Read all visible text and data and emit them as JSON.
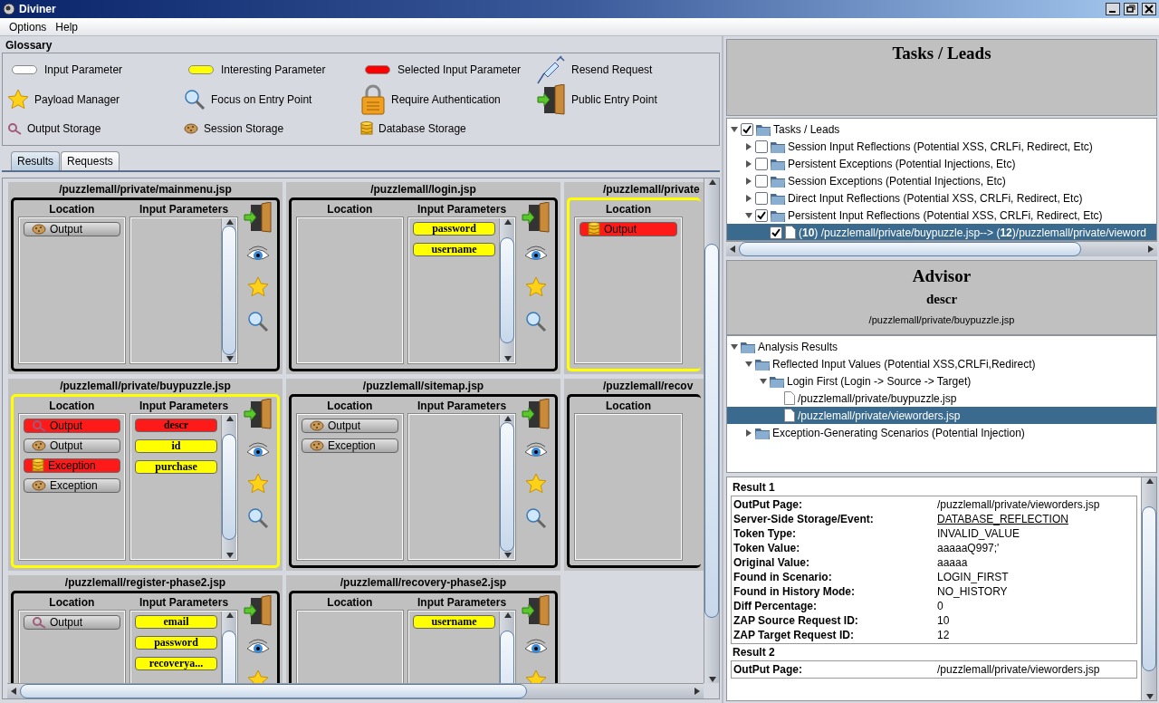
{
  "window": {
    "title": "Diviner"
  },
  "menu": [
    "Options",
    "Help"
  ],
  "glossary": {
    "title": "Glossary",
    "items": [
      {
        "label": "Input Parameter",
        "kind": "pill",
        "color": "#ffffff"
      },
      {
        "label": "Interesting Parameter",
        "kind": "pill",
        "color": "#ffff00"
      },
      {
        "label": "Selected Input Parameter",
        "kind": "pill",
        "color": "#ff0000"
      },
      {
        "label": "Resend Request",
        "kind": "syringe"
      },
      {
        "label": "Payload Manager",
        "kind": "star"
      },
      {
        "label": "Focus on Entry Point",
        "kind": "zoom"
      },
      {
        "label": "Require Authentication",
        "kind": "lock"
      },
      {
        "label": "Public Entry Point",
        "kind": "door"
      },
      {
        "label": "Output Storage",
        "kind": "output"
      },
      {
        "label": "Session Storage",
        "kind": "cookie"
      },
      {
        "label": "Database Storage",
        "kind": "db"
      }
    ]
  },
  "tabs": [
    {
      "label": "Results",
      "selected": true
    },
    {
      "label": "Requests",
      "selected": false
    }
  ],
  "cards": [
    {
      "title": "/puzzlemall/private/mainmenu.jsp",
      "highlighted": false,
      "partial": false,
      "location_header": "Location",
      "params_header": "Input Parameters",
      "locations": [
        {
          "label": "Output",
          "kind": "cookie",
          "selected": false
        }
      ]
    },
    {
      "title": "/puzzlemall/login.jsp",
      "highlighted": false,
      "partial": false,
      "location_header": "Location",
      "params_header": "Input Parameters",
      "params": [
        {
          "label": "password",
          "selected": false
        },
        {
          "label": "username",
          "selected": false
        }
      ]
    },
    {
      "title": "/puzzlemall/private",
      "highlighted": true,
      "partial": true,
      "location_header": "Location",
      "locations": [
        {
          "label": "Output",
          "kind": "db",
          "selected": true
        }
      ]
    },
    {
      "title": "/puzzlemall/private/buypuzzle.jsp",
      "highlighted": true,
      "partial": false,
      "location_header": "Location",
      "params_header": "Input Parameters",
      "locations": [
        {
          "label": "Output",
          "kind": "output",
          "selected": true
        },
        {
          "label": "Output",
          "kind": "cookie",
          "selected": false
        },
        {
          "label": "Exception",
          "kind": "db",
          "selected": true
        },
        {
          "label": "Exception",
          "kind": "cookie",
          "selected": false
        }
      ],
      "params": [
        {
          "label": "descr",
          "selected": true
        },
        {
          "label": "id",
          "selected": false
        },
        {
          "label": "purchase",
          "selected": false
        }
      ]
    },
    {
      "title": "/puzzlemall/sitemap.jsp",
      "highlighted": false,
      "partial": false,
      "location_header": "Location",
      "params_header": "Input Parameters",
      "locations": [
        {
          "label": "Output",
          "kind": "cookie",
          "selected": false
        },
        {
          "label": "Exception",
          "kind": "cookie",
          "selected": false
        }
      ]
    },
    {
      "title": "/puzzlemall/recov",
      "highlighted": false,
      "partial": true,
      "location_header": "Location"
    },
    {
      "title": "/puzzlemall/register-phase2.jsp",
      "highlighted": false,
      "partial": false,
      "location_header": "Location",
      "params_header": "Input Parameters",
      "locations": [
        {
          "label": "Output",
          "kind": "output",
          "selected": false
        }
      ],
      "params": [
        {
          "label": "email",
          "selected": false
        },
        {
          "label": "password",
          "selected": false
        },
        {
          "label": "recoverya...",
          "selected": false
        }
      ]
    },
    {
      "title": "/puzzlemall/recovery-phase2.jsp",
      "highlighted": false,
      "partial": false,
      "location_header": "Location",
      "params_header": "Input Parameters",
      "params": [
        {
          "label": "username",
          "selected": false
        }
      ]
    }
  ],
  "tasks": {
    "title": "Tasks / Leads",
    "tree": [
      {
        "label": "Tasks / Leads",
        "kind": "folder",
        "checked": true,
        "expanded": true,
        "selected": false,
        "children": [
          {
            "label": "Session Input Reflections (Potential XSS, CRLFi, Redirect, Etc)",
            "kind": "folder",
            "checked": false,
            "expanded": false,
            "selected": false
          },
          {
            "label": "Persistent Exceptions (Potential Injections, Etc)",
            "kind": "folder",
            "checked": false,
            "expanded": false,
            "selected": false
          },
          {
            "label": "Session Exceptions (Potential Injections, Etc)",
            "kind": "folder",
            "checked": false,
            "expanded": false,
            "selected": false
          },
          {
            "label": "Direct Input Reflections (Potential XSS, CRLFi, Redirect, Etc)",
            "kind": "folder",
            "checked": false,
            "expanded": false,
            "selected": false
          },
          {
            "label": "Persistent Input Reflections (Potential XSS, CRLFi, Redirect, Etc)",
            "kind": "folder",
            "checked": true,
            "expanded": true,
            "selected": false,
            "children": [
              {
                "label": "(**10**) /puzzlemall/private/buypuzzle.jsp--> (**12**)/puzzlemall/private/vieword",
                "kind": "file",
                "checked": true,
                "selected": true
              }
            ]
          }
        ]
      }
    ]
  },
  "advisor": {
    "title": "Advisor",
    "parameter": "descr",
    "page": "/puzzlemall/private/buypuzzle.jsp",
    "tree": [
      {
        "label": "Analysis Results",
        "kind": "folder",
        "expanded": true,
        "selected": false,
        "children": [
          {
            "label": "Reflected Input Values (Potential XSS,CRLFi,Redirect)",
            "kind": "folder",
            "expanded": true,
            "selected": false,
            "children": [
              {
                "label": "Login First (Login -> Source -> Target)",
                "kind": "folder",
                "expanded": true,
                "selected": false,
                "children": [
                  {
                    "label": "/puzzlemall/private/buypuzzle.jsp",
                    "kind": "file",
                    "selected": false
                  },
                  {
                    "label": "/puzzlemall/private/vieworders.jsp",
                    "kind": "file",
                    "selected": true
                  }
                ]
              }
            ]
          },
          {
            "label": "Exception-Generating Scenarios (Potential Injection)",
            "kind": "folder",
            "expanded": false,
            "selected": false
          }
        ]
      }
    ]
  },
  "results": [
    {
      "title": "Result 1",
      "fields": [
        {
          "label": "OutPut Page:",
          "value": "/puzzlemall/private/vieworders.jsp",
          "kind": "text"
        },
        {
          "label": "Server-Side Storage/Event:",
          "value": "DATABASE_REFLECTION",
          "kind": "link"
        },
        {
          "label": "Token Type:",
          "value": "INVALID_VALUE",
          "kind": "text"
        },
        {
          "label": "Token Value:",
          "value": "aaaaaQ997;'",
          "kind": "text"
        },
        {
          "label": "Original Value:",
          "value": "aaaaa",
          "kind": "text"
        },
        {
          "label": "Found in Scenario:",
          "value": "LOGIN_FIRST",
          "kind": "text"
        },
        {
          "label": "Found in History Mode:",
          "value": "NO_HISTORY",
          "kind": "text"
        },
        {
          "label": "Diff Percentage:",
          "value": "0",
          "kind": "text"
        },
        {
          "label": "ZAP Source Request ID:",
          "value": "10",
          "kind": "text"
        },
        {
          "label": "ZAP Target Request ID:",
          "value": "12",
          "kind": "text"
        }
      ]
    },
    {
      "title": "Result 2",
      "fields": [
        {
          "label": "OutPut Page:",
          "value": "/puzzlemall/private/vieworders.jsp",
          "kind": "text"
        }
      ]
    }
  ]
}
